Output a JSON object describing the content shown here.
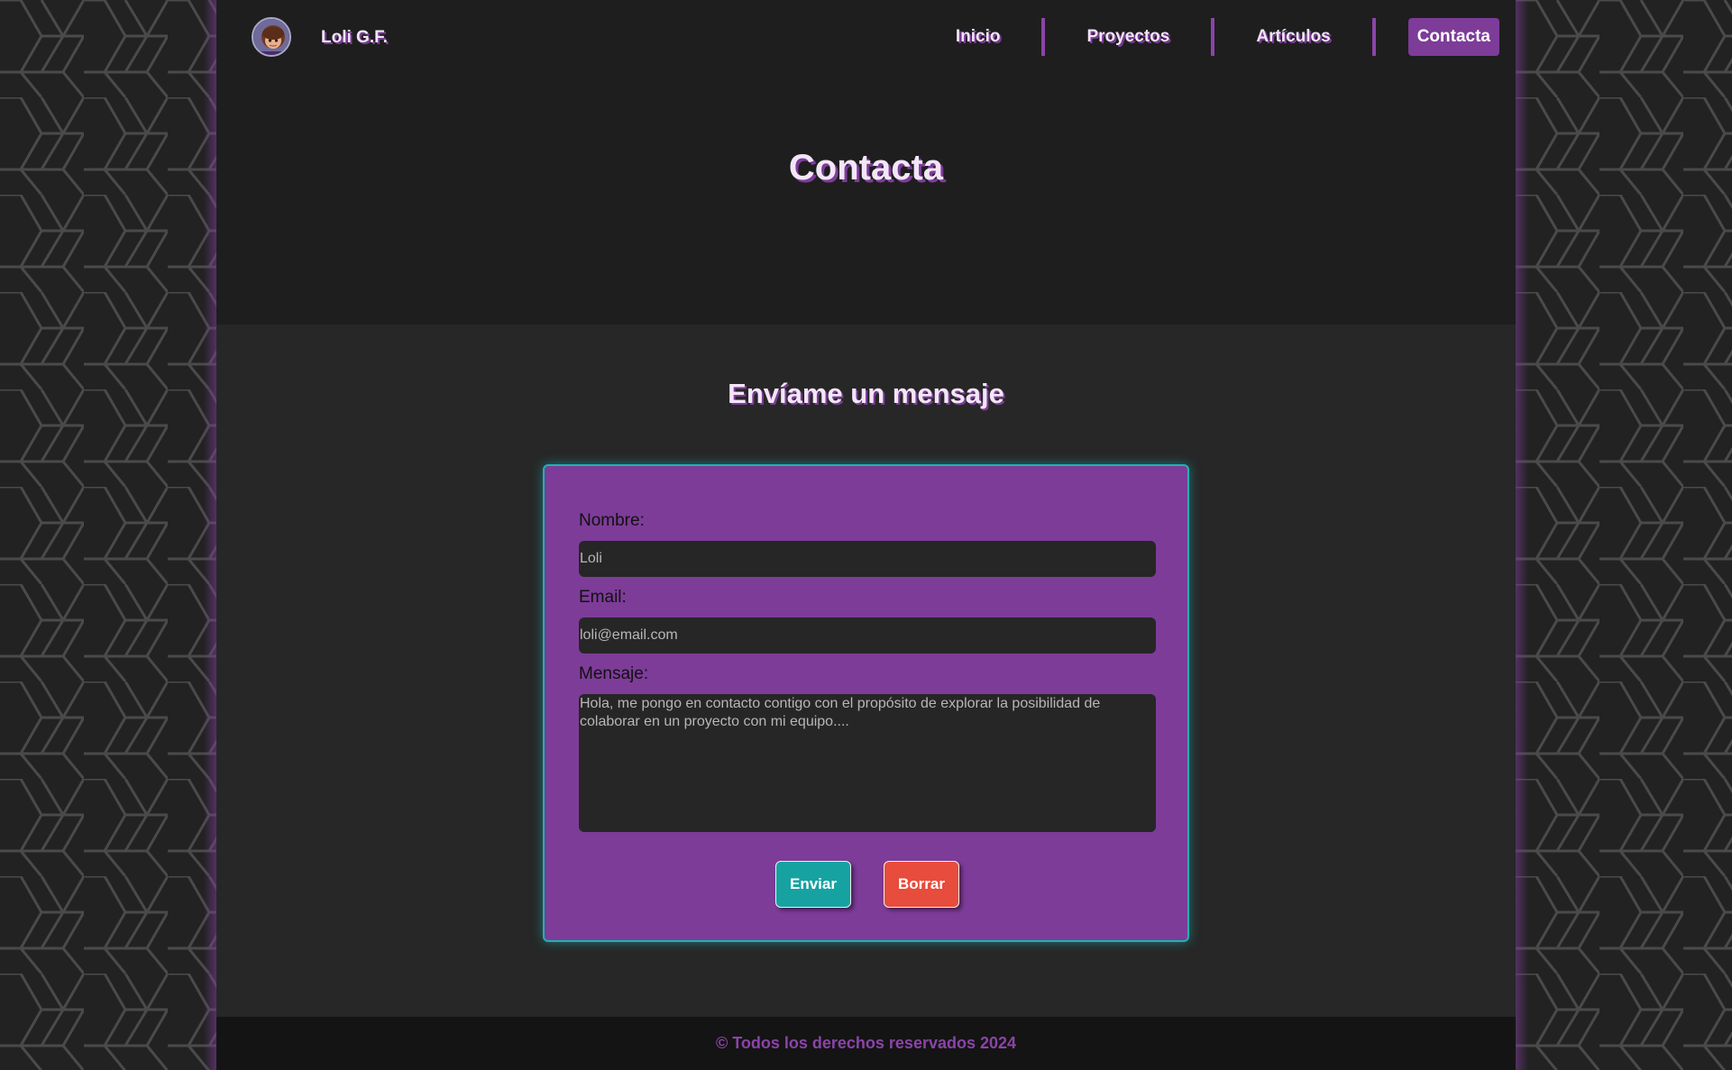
{
  "header": {
    "brand": "Loli G.F.",
    "nav": [
      {
        "label": "Inicio"
      },
      {
        "label": "Proyectos"
      },
      {
        "label": "Artículos"
      },
      {
        "label": "Contacta",
        "active": true
      }
    ]
  },
  "hero": {
    "title": "Contacta"
  },
  "contact": {
    "title": "Envíame un mensaje",
    "name_label": "Nombre:",
    "name_placeholder": "Loli",
    "email_label": "Email:",
    "email_placeholder": "loli@email.com",
    "message_label": "Mensaje:",
    "message_placeholder": "Hola, me pongo en contacto contigo con el propósito de explorar la posibilidad de colaborar en un proyecto con mi equipo....",
    "send_label": "Enviar",
    "clear_label": "Borrar"
  },
  "footer": {
    "text": "© Todos los derechos reservados 2024"
  },
  "colors": {
    "accent": "#7d3c98",
    "teal": "#17a2a2",
    "danger": "#e74c3c",
    "background": "#1e1e1e"
  }
}
